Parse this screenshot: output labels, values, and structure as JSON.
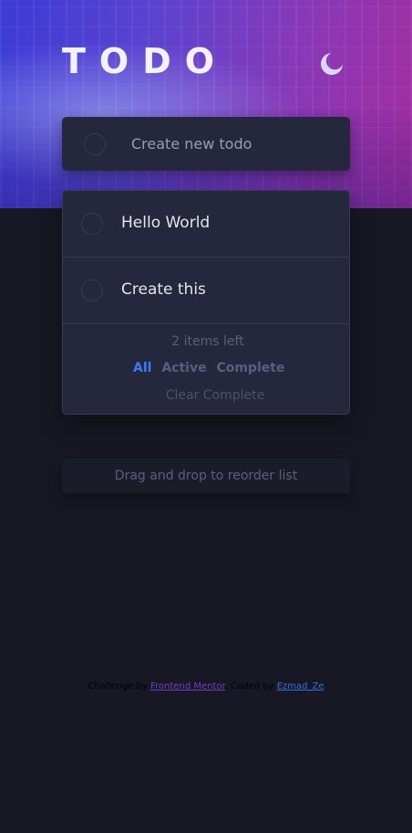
{
  "header": {
    "title": "TODO",
    "theme_icon": "moon-icon"
  },
  "new_todo": {
    "placeholder": "Create new todo",
    "value": ""
  },
  "todos": [
    {
      "text": "Hello World",
      "completed": false
    },
    {
      "text": "Create this",
      "completed": false
    }
  ],
  "footer": {
    "items_left": "2 items left",
    "filters": {
      "all": "All",
      "active": "Active",
      "complete": "Complete"
    },
    "active_filter": "All",
    "clear_label": "Clear Complete"
  },
  "hint": "Drag and drop to reorder list",
  "attribution": {
    "prefix": "Challenge by",
    "link1": "Frontend Mentor",
    "middle": ". Coded by",
    "link2": "Ezmad_Ze"
  },
  "colors": {
    "accent": "#3a7cfd",
    "background": "#181824",
    "card": "#25273c"
  }
}
